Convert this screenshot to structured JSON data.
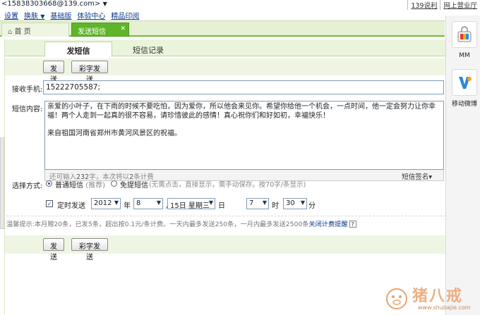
{
  "topbar": {
    "account": "<15838303668@139.com>",
    "menu": [
      "设置",
      "换肤",
      "基础版",
      "体验中心",
      "精品印阅"
    ],
    "right": [
      "139说利",
      "网上营业厅"
    ]
  },
  "tabs": {
    "home": "首 页",
    "sms": "发送短信"
  },
  "subtabs": {
    "send": "发短信",
    "log": "短信记录"
  },
  "buttons": {
    "send": "发送",
    "mms": "彩字发送"
  },
  "form": {
    "phone_label": "接收手机:",
    "phone_value": "15222705587;",
    "content_label": "短信内容:",
    "message": "亲爱的小叶子，在下雨的时候不要吃怕，因为爱你，所以他会来见你。希望你给他一个机会，一点时间，他一定会努力让你幸福！两个人走到一起真的很不容易，请珍惜彼此的感情！真心祝你们和好如初，幸福快乐！",
    "message_sign": "来自祖国河南省郑州市黄河风景区的祝福。",
    "remaining_prefix": "还可输入",
    "remaining_count": "232",
    "remaining_mid": "字，本次将以",
    "count_billed": "2",
    "remaining_suffix": "条计费",
    "signature": "短信签名▾",
    "type_label": "选择方式:",
    "normal_label": "普通短信",
    "normal_note": "(推荐)",
    "free_label": "免提短信",
    "free_note": "(无需点击，直接显示，需手动保存。按70字/条显示)",
    "timed_label": "定时发送",
    "year": "2012",
    "year_unit": "年",
    "month": "8",
    "month_unit": "月",
    "day": "15日 星期三",
    "day_unit": "日",
    "hour": "7",
    "hour_unit": "时",
    "minute": "30",
    "minute_unit": "分"
  },
  "tip": {
    "text": "温馨提示:本月赠20条，已发5条，超出按0.1元/条计费。一天内最多发送250条，一月内最多发送2500条",
    "link": "关闭计费提醒",
    "help": "?"
  },
  "rightpanel": {
    "apps": [
      {
        "label": "MM",
        "icon": "mm-bag-icon"
      },
      {
        "label": "移动微博",
        "icon": "weibo-icon"
      }
    ]
  },
  "watermark": {
    "text": "猪八戒",
    "url": "www.shubajie.com"
  },
  "colors": {
    "accent_green": "#5fb52a",
    "tab_bg": "#e6f1d4",
    "link_blue": "#0b3a8c"
  }
}
